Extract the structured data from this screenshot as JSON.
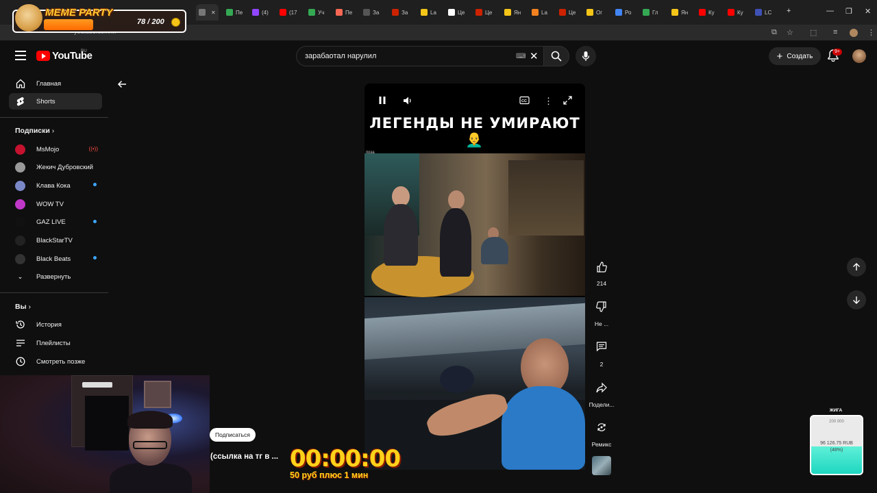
{
  "browser": {
    "tabs": [
      {
        "label": "",
        "color": "#777777"
      },
      {
        "label": "Пе",
        "color": "#34a853"
      },
      {
        "label": "(4)",
        "color": "#9146ff"
      },
      {
        "label": "(17",
        "color": "#ff0000"
      },
      {
        "label": "Уч",
        "color": "#34a853"
      },
      {
        "label": "Пе",
        "color": "#f96854"
      },
      {
        "label": "За",
        "color": "#555555"
      },
      {
        "label": "За",
        "color": "#cc2200"
      },
      {
        "label": "La",
        "color": "#f5c518"
      },
      {
        "label": "Це",
        "color": "#ffffff"
      },
      {
        "label": "Це",
        "color": "#cc2200"
      },
      {
        "label": "Ян",
        "color": "#f5c518"
      },
      {
        "label": "La",
        "color": "#f58220"
      },
      {
        "label": "Це",
        "color": "#cc2200"
      },
      {
        "label": "Ог",
        "color": "#f5c518"
      },
      {
        "label": "Ро",
        "color": "#4285f4"
      },
      {
        "label": "Гл",
        "color": "#34a853"
      },
      {
        "label": "Ян",
        "color": "#f5c518"
      },
      {
        "label": "Ку",
        "color": "#ff0000"
      },
      {
        "label": "Ку",
        "color": "#ff0000"
      },
      {
        "label": "LC",
        "color": "#3f51b5"
      }
    ],
    "url": "youtube.com/..."
  },
  "meme_widget": {
    "title": "MEME PARTY",
    "count": "78 / 200"
  },
  "header": {
    "logo_text": "YouTube",
    "logo_sup": "RU",
    "search_value": "зарабаотал нарулил",
    "create_label": "Создать",
    "notif_badge": "9+"
  },
  "sidebar": {
    "main": [
      {
        "label": "Главная",
        "icon": "home-icon"
      },
      {
        "label": "Shorts",
        "icon": "shorts-icon"
      }
    ],
    "subs_header": "Подписки",
    "subscriptions": [
      {
        "label": "MsMojo",
        "color": "#c4122f",
        "live": "red"
      },
      {
        "label": "Жекич Дубровский",
        "color": "#9a9a9a",
        "live": ""
      },
      {
        "label": "Клава Кока",
        "color": "#7a88c8",
        "live": "blue"
      },
      {
        "label": "WOW TV",
        "color": "#c038c8",
        "live": ""
      },
      {
        "label": "GAZ LIVE",
        "color": "#111111",
        "live": "blue"
      },
      {
        "label": "BlackStarTV",
        "color": "#222222",
        "live": ""
      },
      {
        "label": "Black Beats",
        "color": "#333333",
        "live": "blue"
      }
    ],
    "expand_label": "Развернуть",
    "you_header": "Вы",
    "you_items": [
      {
        "label": "История",
        "icon": "history-icon"
      },
      {
        "label": "Плейлисты",
        "icon": "playlist-icon"
      },
      {
        "label": "Смотреть позже",
        "icon": "clock-icon"
      }
    ]
  },
  "video": {
    "caption": "ЛЕГЕНДЫ НЕ УМИРАЮТ👨‍🦲",
    "small_text": "прза"
  },
  "actions": {
    "likes": "214",
    "dislike_label": "Не ...",
    "comments": "2",
    "share_label": "Подели...",
    "remix_label": "Ремикс"
  },
  "stream": {
    "subscribe_label": "Подписаться",
    "tg_text": "(ссылка на тг в ...",
    "timer": "00:00:00",
    "timer_sub": "50 руб плюс 1 мин"
  },
  "goal": {
    "title": "ЖИГА",
    "target": "200 000",
    "amount": "96 126.75 RUB",
    "percent_text": "(48%)",
    "progress": 0.48
  }
}
